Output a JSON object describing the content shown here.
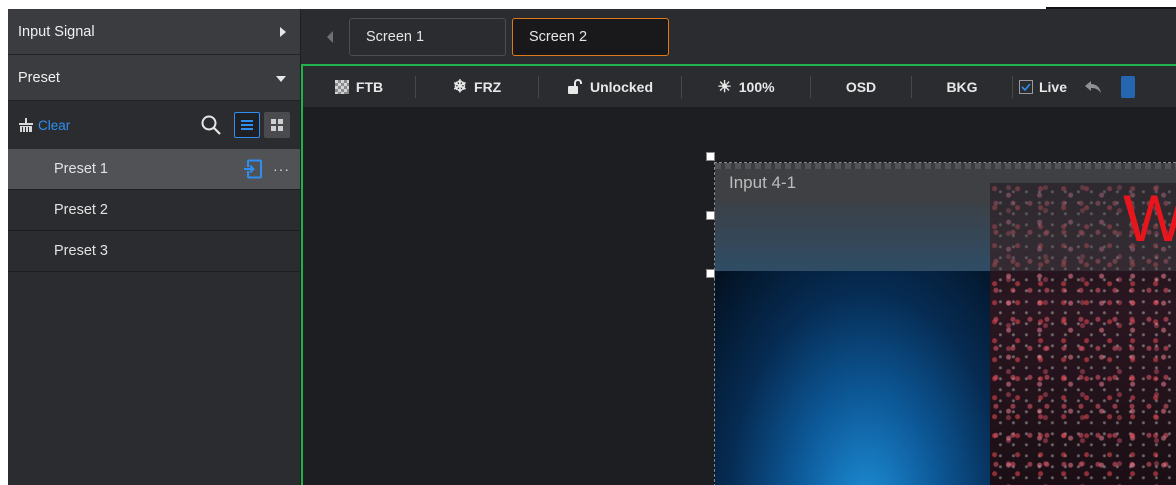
{
  "sidebar": {
    "input_signal": {
      "label": "Input Signal",
      "expanded": false
    },
    "preset": {
      "label": "Preset",
      "expanded": true
    },
    "toolbar": {
      "clear_label": "Clear",
      "icons": [
        "broom-icon",
        "search-icon",
        "list-view-icon",
        "grid-view-icon"
      ],
      "active_view": "list"
    },
    "presets": [
      {
        "label": "Preset 1",
        "selected": true
      },
      {
        "label": "Preset 2",
        "selected": false
      },
      {
        "label": "Preset 3",
        "selected": false
      }
    ]
  },
  "screens": {
    "tabs": [
      {
        "label": "Screen 1",
        "active": false
      },
      {
        "label": "Screen 2",
        "active": true
      }
    ]
  },
  "controls": {
    "ftb": "FTB",
    "frz": "FRZ",
    "lock": "Unlocked",
    "brightness": "100%",
    "osd": "OSD",
    "bkg": "BKG",
    "live": "Live",
    "live_checked": true
  },
  "canvas": {
    "window_title": "Input 4-1",
    "overlay_text": "W"
  },
  "colors": {
    "accent_blue": "#2e8ff0",
    "active_tab_border": "#e07a19",
    "canvas_border": "#22b14c",
    "overlay_red": "#e8161c"
  }
}
